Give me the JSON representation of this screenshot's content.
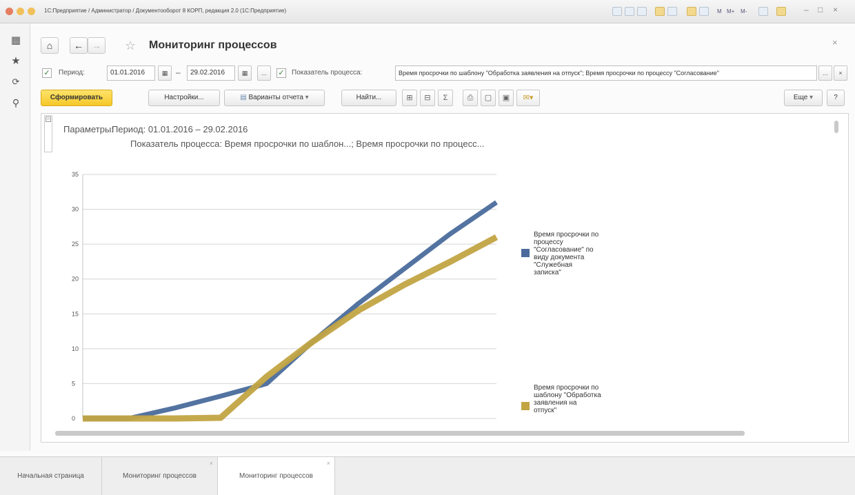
{
  "window": {
    "title": "1С:Предприятие / Администратор / Документооборот 8 КОРП, редакция 2.0 (1С:Предприятие)",
    "toolbar_text": [
      "M",
      "M+",
      "M-"
    ]
  },
  "left_panel": {
    "icons": [
      "apps-grid-icon",
      "favorites-star-icon",
      "history-icon",
      "search-icon"
    ]
  },
  "form": {
    "title": "Мониторинг процессов",
    "nav": {
      "home_icon": "home-icon",
      "back_icon": "back-arrow-icon",
      "forward_icon": "forward-arrow-icon"
    },
    "filter": {
      "period_label": "Период:",
      "period_from": "01.01.2016",
      "dash": "–",
      "period_to": "29.02.2016",
      "ellipsis": "...",
      "indicator_label": "Показатель процесса:",
      "indicator_value": "Время просрочки по шаблону \"Обработка заявления на отпуск\"; Время просрочки по процессу \"Согласование\"",
      "indicator_btn": "...",
      "clear_btn": "×"
    },
    "toolbar": {
      "generate": "Сформировать",
      "settings": "Настройки...",
      "variants": "Варианты отчета",
      "find": "Найти...",
      "more": "Еще",
      "help": "?"
    },
    "report": {
      "params_label": "Параметры:",
      "params_period": "Период: 01.01.2016 – 29.02.2016",
      "params_indicator": "Показатель процесса: Время просрочки по шаблон...; Время просрочки по процесс..."
    }
  },
  "tabs": [
    {
      "label": "Начальная страница",
      "active": false,
      "closable": false
    },
    {
      "label": "Мониторинг процессов",
      "active": false,
      "closable": true
    },
    {
      "label": "Мониторинг процессов",
      "active": true,
      "closable": true
    }
  ],
  "colors": {
    "series1": "#4a6b9c",
    "series2": "#c2a443",
    "primary_button": "#f5c82a"
  },
  "chart_data": {
    "type": "line",
    "title": "",
    "xlabel": "",
    "ylabel": "",
    "ylim": [
      0,
      35
    ],
    "yticks": [
      0,
      5,
      10,
      15,
      20,
      25,
      30,
      35
    ],
    "grid": true,
    "legend_position": "right",
    "x": [
      0,
      1,
      2,
      3,
      4,
      5,
      6,
      7,
      8,
      9
    ],
    "series": [
      {
        "name": "Время просрочки по процессу \"Согласование\" по виду документа \"Служебная записка\"",
        "color": "#4a6b9c",
        "values": [
          0,
          0,
          1.5,
          3.2,
          5,
          11,
          16.5,
          21.5,
          26.5,
          31
        ]
      },
      {
        "name": "Время просрочки по шаблону \"Обработка заявления на отпуск\"",
        "color": "#c2a443",
        "values": [
          0,
          0,
          0,
          0.1,
          6,
          11,
          15.5,
          19.2,
          22.5,
          26
        ]
      }
    ]
  }
}
